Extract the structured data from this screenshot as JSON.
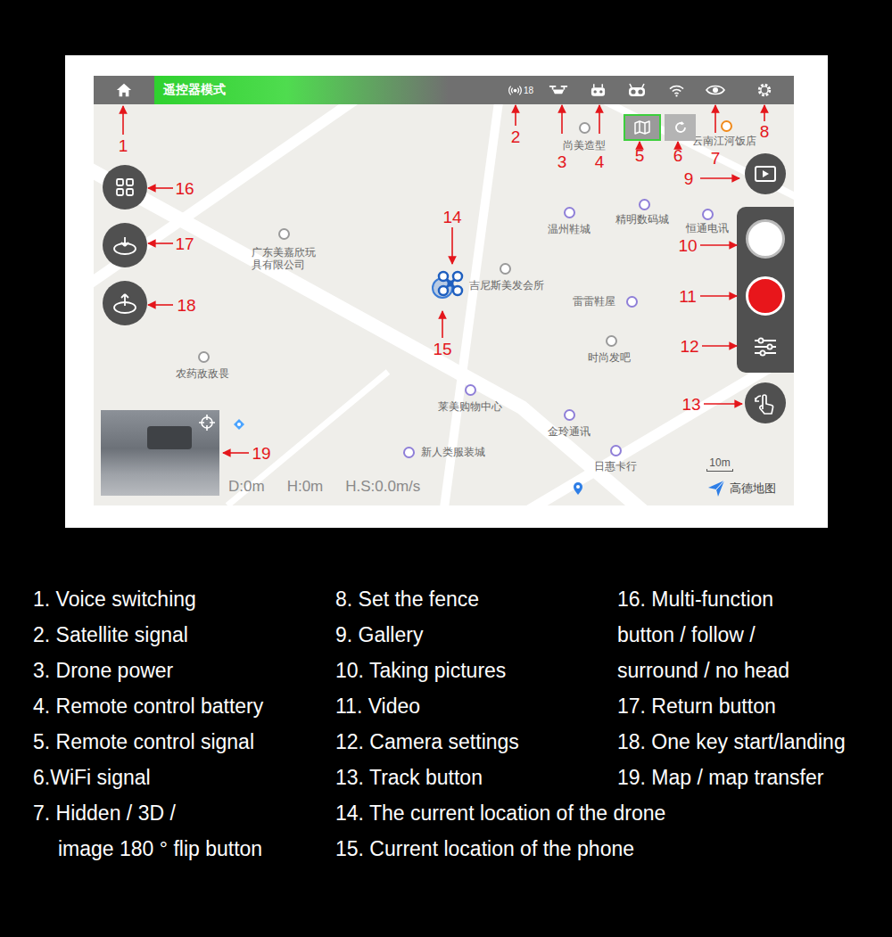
{
  "top_bar": {
    "mode_label": "遥控器模式",
    "satellite_count": "18"
  },
  "map_layer_buttons": [
    {
      "selected": true
    },
    {
      "selected": false
    }
  ],
  "map": {
    "places": [
      {
        "name": "尚美造型",
        "color": "#9a9a9a"
      },
      {
        "name": "云南江河饭店",
        "color": "#f08a1c"
      },
      {
        "name": "广东美嘉欣玩具有限公司",
        "color": "#9a9a9a"
      },
      {
        "name": "温州鞋城",
        "color": "#8f7fd8"
      },
      {
        "name": "精明数码城",
        "color": "#8f7fd8"
      },
      {
        "name": "恒通电讯",
        "color": "#8f7fd8"
      },
      {
        "name": "吉尼斯美发会所",
        "color": "#9a9a9a"
      },
      {
        "name": "雷雷鞋屋",
        "color": "#8f7fd8"
      },
      {
        "name": "时尚发吧",
        "color": "#9a9a9a"
      },
      {
        "name": "农药敌敌畏",
        "color": "#9a9a9a"
      },
      {
        "name": "莱美购物中心",
        "color": "#8f7fd8"
      },
      {
        "name": "金玲通讯",
        "color": "#8f7fd8"
      },
      {
        "name": "新人类服装城",
        "color": "#8f7fd8"
      },
      {
        "name": "日惠卡行",
        "color": "#8f7fd8"
      }
    ],
    "scale": "10m",
    "provider": "高德地图"
  },
  "telemetry": [
    "D:0m",
    "H:0m",
    "H.S:0.0m/s"
  ],
  "callouts": [
    "1",
    "2",
    "3",
    "4",
    "5",
    "6",
    "7",
    "8",
    "9",
    "10",
    "11",
    "12",
    "13",
    "14",
    "15",
    "16",
    "17",
    "18",
    "19"
  ],
  "legend": [
    {
      "lines": [
        "1. Voice switching"
      ]
    },
    {
      "lines": [
        "2. Satellite signal"
      ]
    },
    {
      "lines": [
        "3. Drone power"
      ]
    },
    {
      "lines": [
        "4. Remote control battery"
      ]
    },
    {
      "lines": [
        "5. Remote control signal"
      ]
    },
    {
      "lines": [
        "6.WiFi signal"
      ]
    },
    {
      "lines": [
        "7. Hidden / 3D /",
        "image 180 ° flip button"
      ]
    },
    {
      "lines": [
        "8. Set the fence"
      ]
    },
    {
      "lines": [
        "9. Gallery"
      ]
    },
    {
      "lines": [
        "10. Taking pictures"
      ]
    },
    {
      "lines": [
        "11. Video"
      ]
    },
    {
      "lines": [
        "12. Camera settings"
      ]
    },
    {
      "lines": [
        "13. Track button"
      ]
    },
    {
      "lines": [
        "14. The current location of the drone"
      ]
    },
    {
      "lines": [
        "15. Current location of the phone"
      ]
    },
    {
      "lines": [
        "16. Multi-function",
        "button / follow /",
        "surround / no head"
      ]
    },
    {
      "lines": [
        "17. Return button"
      ]
    },
    {
      "lines": [
        "18. One key start/landing"
      ]
    },
    {
      "lines": [
        "19. Map / map transfer"
      ]
    }
  ]
}
